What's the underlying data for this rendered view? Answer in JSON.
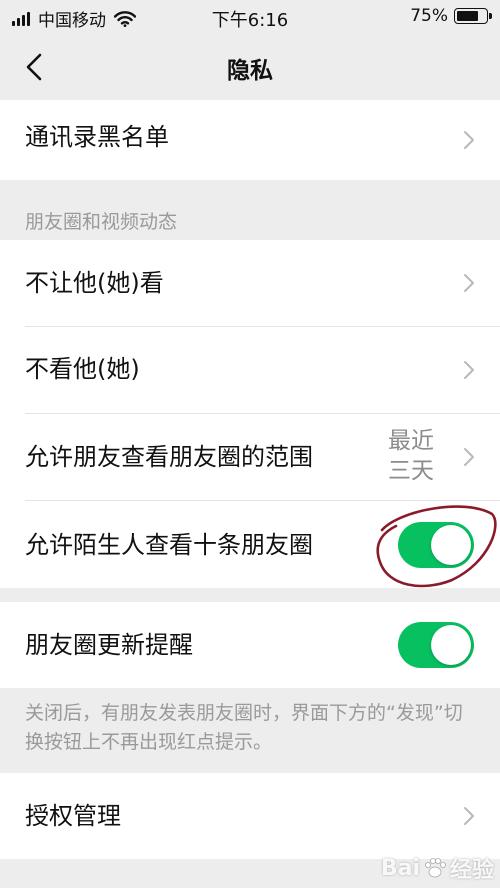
{
  "status_bar": {
    "carrier": "中国移动",
    "time": "下午6:16",
    "battery_text": "75%",
    "battery_level": 0.75,
    "icons": [
      "signal-icon",
      "wifi-icon",
      "battery-icon"
    ]
  },
  "nav": {
    "title": "隐私",
    "back_icon": "chevron-left-icon"
  },
  "rows": {
    "blacklist": "通讯录黑名单",
    "section_moments": "朋友圈和视频动态",
    "dont_let_see": "不让他(她)看",
    "dont_see": "不看他(她)",
    "range": {
      "label": "允许朋友查看朋友圈的范围",
      "value": "最近\n三天"
    },
    "strangers": {
      "label": "允许陌生人查看十条朋友圈",
      "on": true
    },
    "update_reminder": {
      "label": "朋友圈更新提醒",
      "on": true
    },
    "footnote": "关闭后，有朋友发表朋友圈时，界面下方的“发现”切换按钮上不再出现红点提示。",
    "authorization": "授权管理"
  },
  "watermark": {
    "text_left": "Bai",
    "text_right": "经验"
  },
  "colors": {
    "background": "#ededed",
    "toggle_on": "#07c160",
    "annotation_circle": "#8b1a2b",
    "secondary_text": "#9a9a9a"
  }
}
